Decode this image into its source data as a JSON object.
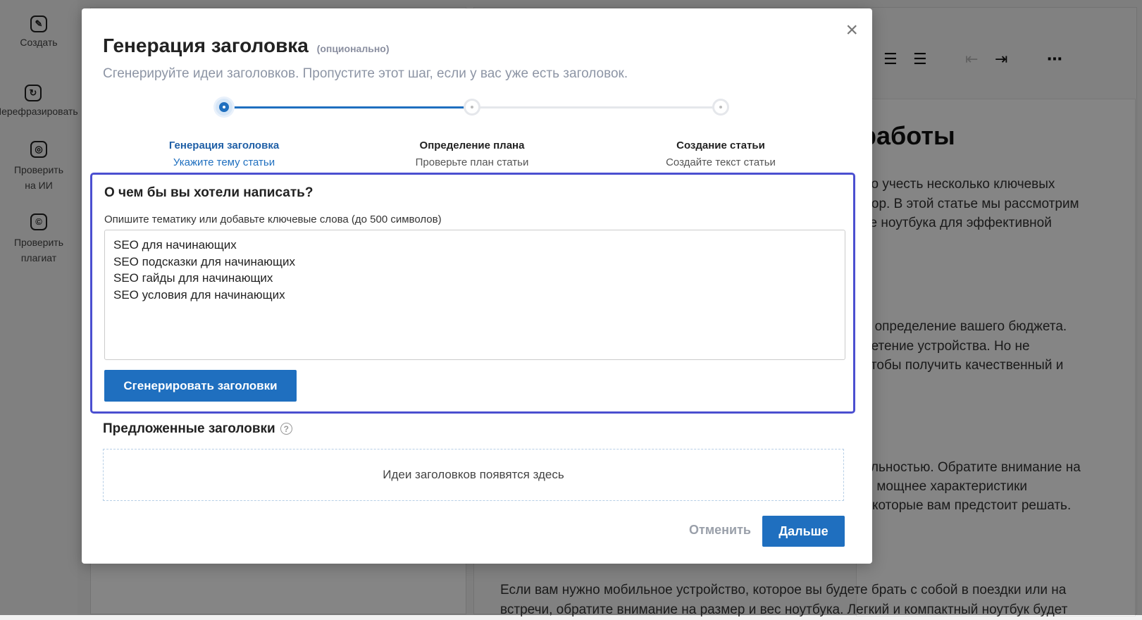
{
  "sidebar": {
    "items": [
      {
        "label": "Создать",
        "icon": "pencil-icon"
      },
      {
        "label": "Перефразировать",
        "icon": "refresh-icon"
      },
      {
        "label": "Проверить на ИИ",
        "icon": "ai-check-icon"
      },
      {
        "label": "Проверить плагиат",
        "icon": "copyright-icon"
      }
    ]
  },
  "toolbar": {
    "icons": [
      "align-right-icon",
      "align-justify-icon",
      "outdent-icon",
      "indent-icon",
      "more-icon"
    ]
  },
  "article": {
    "heading": "работы",
    "lines": [
      "но учесть несколько ключевых",
      "бор. В этой статье мы рассмотрим",
      "ке ноутбука для эффективной",
      "я определение вашего бюджета.",
      "ретение устройства. Но не",
      "чтобы получить качественный и",
      "ельностью. Обратите внимание на",
      "м мощнее характеристики",
      "которые вам предстоит решать.",
      "Если вам нужно мобильное устройство, которое вы будете брать с собой в поездки или на",
      "встречи, обратите внимание на размер и вес ноутбука. Легкий и компактный ноутбук будет"
    ]
  },
  "modal": {
    "title": "Генерация заголовка",
    "optional": "(опционально)",
    "subtitle": "Сгенерируйте идеи заголовков. Пропустите этот шаг, если у вас уже есть заголовок.",
    "close_label": "×",
    "steps": [
      {
        "label": "Генерация заголовка",
        "desc": "Укажите тему статьи",
        "state": "active"
      },
      {
        "label": "Определение плана",
        "desc": "Проверьте план статьи",
        "state": "pending"
      },
      {
        "label": "Создание статьи",
        "desc": "Создайте текст статьи",
        "state": "pending"
      }
    ],
    "progress": 0.5,
    "question": "О чем бы вы хотели написать?",
    "hint": "Опишите тематику или добавьте ключевые слова (до 500 символов)",
    "textarea_lines": [
      "SEO для начинающих",
      "SEO подсказки для начинающих",
      "SEO гайды для начинающих",
      "SEO условия для начинающих"
    ],
    "generate_button": "Сгенерировать заголовки",
    "suggestions_title": "Предложенные заголовки",
    "suggestions_placeholder": "Идеи заголовков появятся здесь",
    "cancel_button": "Отменить",
    "next_button": "Дальше"
  },
  "colors": {
    "accent": "#1f6fbf",
    "focus_border": "#4b4fd0",
    "overlay": "rgba(0,0,0,0.48)"
  }
}
